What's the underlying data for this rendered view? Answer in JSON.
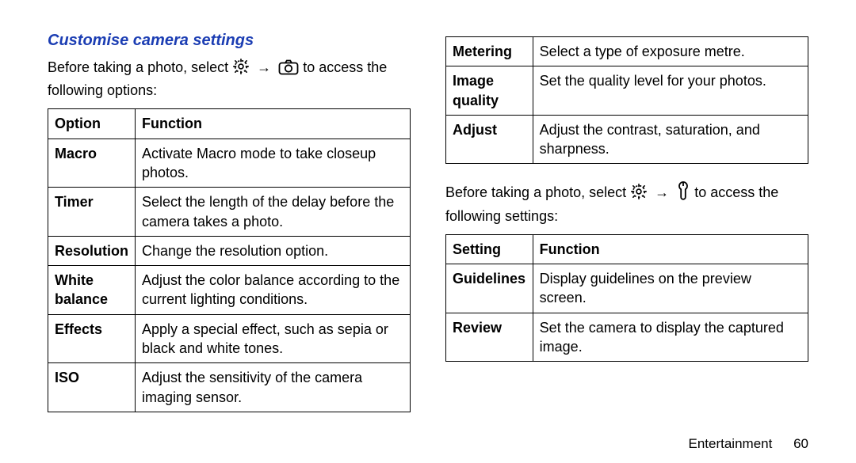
{
  "title": "Customise camera settings",
  "lead1_pre": "Before taking a photo, select ",
  "lead1_mid": " → ",
  "lead1_post": " to access the following options:",
  "lead2_pre": "Before taking a photo, select ",
  "lead2_mid": " → ",
  "lead2_post": " to access the following settings:",
  "table1": {
    "h1": "Option",
    "h2": "Function",
    "rows": [
      {
        "k": "Macro",
        "v": "Activate Macro mode to take closeup photos."
      },
      {
        "k": "Timer",
        "v": "Select the length of the delay before the camera takes a photo."
      },
      {
        "k": "Resolution",
        "v": "Change the resolution option."
      },
      {
        "k": "White balance",
        "v": "Adjust the color balance according to the current lighting conditions."
      },
      {
        "k": "Effects",
        "v": "Apply a special effect, such as sepia or black and white tones."
      },
      {
        "k": "ISO",
        "v": "Adjust the sensitivity of the camera imaging sensor."
      }
    ]
  },
  "table2": {
    "rows": [
      {
        "k": "Metering",
        "v": "Select a type of exposure metre."
      },
      {
        "k": "Image quality",
        "v": "Set the quality level for your photos."
      },
      {
        "k": "Adjust",
        "v": "Adjust the contrast, saturation, and sharpness."
      }
    ]
  },
  "table3": {
    "h1": "Setting",
    "h2": "Function",
    "rows": [
      {
        "k": "Guidelines",
        "v": "Display guidelines on the preview screen."
      },
      {
        "k": "Review",
        "v": "Set the camera to display the captured image."
      }
    ]
  },
  "footer": {
    "section": "Entertainment",
    "page": "60"
  }
}
